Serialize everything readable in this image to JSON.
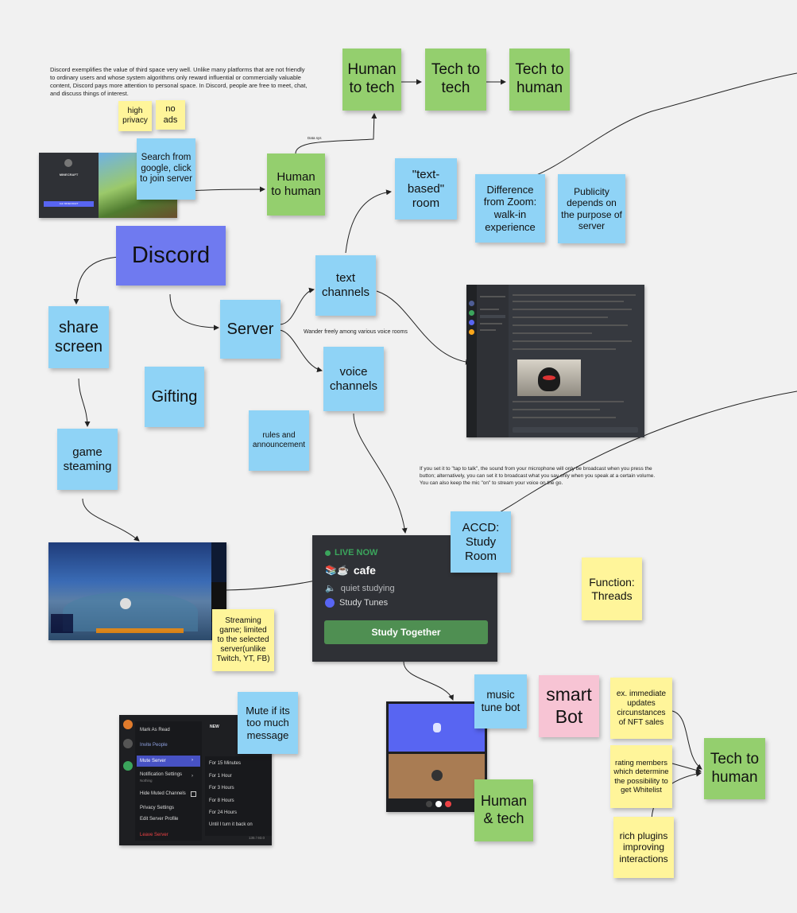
{
  "intro_text": "Discord exemplifies the value of third space very well. Unlike many platforms that are not friendly to ordinary users and whose system algorithms only reward influential or commercially valuable content, Discord pays more attention to personal space. In Discord, people are free to meet, chat, and discuss things of interest.",
  "notes": {
    "high_privacy": "high privacy",
    "no_ads": "no ads",
    "human_to_tech_top": "Human to tech",
    "tech_to_tech": "Tech to tech",
    "tech_to_human_top": "Tech to human",
    "search_google": "Search from google, click to join server",
    "human_to_human": "Human to human",
    "text_based_room": "\"text-based\" room",
    "difference_zoom": "Difference from Zoom: walk-in experience",
    "publicity": "Publicity depends on the purpose of server",
    "discord": "Discord",
    "text_channels": "text channels",
    "share_screen": "share screen",
    "server": "Server",
    "gifting": "Gifting",
    "voice_channels": "voice channels",
    "rules": "rules and announcement",
    "game_streaming": "game steaming",
    "accd": "ACCD: Study Room",
    "function_threads": "Function: Threads",
    "streaming_game": "Streaming game; limited to the selected server(unlike Twitch, YT, FB)",
    "mute_note": "Mute if its too much message",
    "music_bot": "music tune bot",
    "smart_bot": "smart Bot",
    "nft": "ex. immediate updates circunstances of NFT sales",
    "rating": "rating members which determine the possibility to get Whitelist",
    "tech_to_human_bottom": "Tech to human",
    "human_and_tech": "Human & tech",
    "plugins": "rich plugins improving interactions"
  },
  "captions": {
    "arrow_label": "Data sys",
    "wander": "Wander freely among various voice rooms",
    "tap_to_talk": "If you set it to \"tap to talk\", the sound from your microphone will only be broadcast when you press the button; alternatively, you can set it to broadcast what you say only when you speak at a certain volume. You can also keep the mic \"on\" to stream your voice on the go."
  },
  "study_card": {
    "live": "LIVE NOW",
    "emoji": "📚☕",
    "name": "cafe",
    "channel": "quiet studying",
    "bot": "Study Tunes",
    "button": "Study Together"
  },
  "mc_shot": {
    "title": "MINECRAFT",
    "button": "Join MINECRAFT"
  },
  "menu": {
    "badge": "NEW",
    "items": [
      "Mark As Read",
      "Invite People",
      "Mute Server",
      "Notification Settings",
      "Hide Muted Channels",
      "Privacy Settings",
      "Edit Server Profile",
      "Leave Server"
    ],
    "notif_sub": "Nothing",
    "durations": [
      "For 15 Minutes",
      "For 1 Hour",
      "For 3 Hours",
      "For 8 Hours",
      "For 24 Hours",
      "Until I turn it back on"
    ],
    "footer": "135 / 93.0"
  },
  "colors": {
    "blue_note": "#8fd3f6",
    "green_note": "#94cf6e",
    "yellow_note": "#fff59a",
    "pink_note": "#f7c4d4",
    "discord_purple": "#6f7af0",
    "discord_dark": "#2f3136"
  }
}
